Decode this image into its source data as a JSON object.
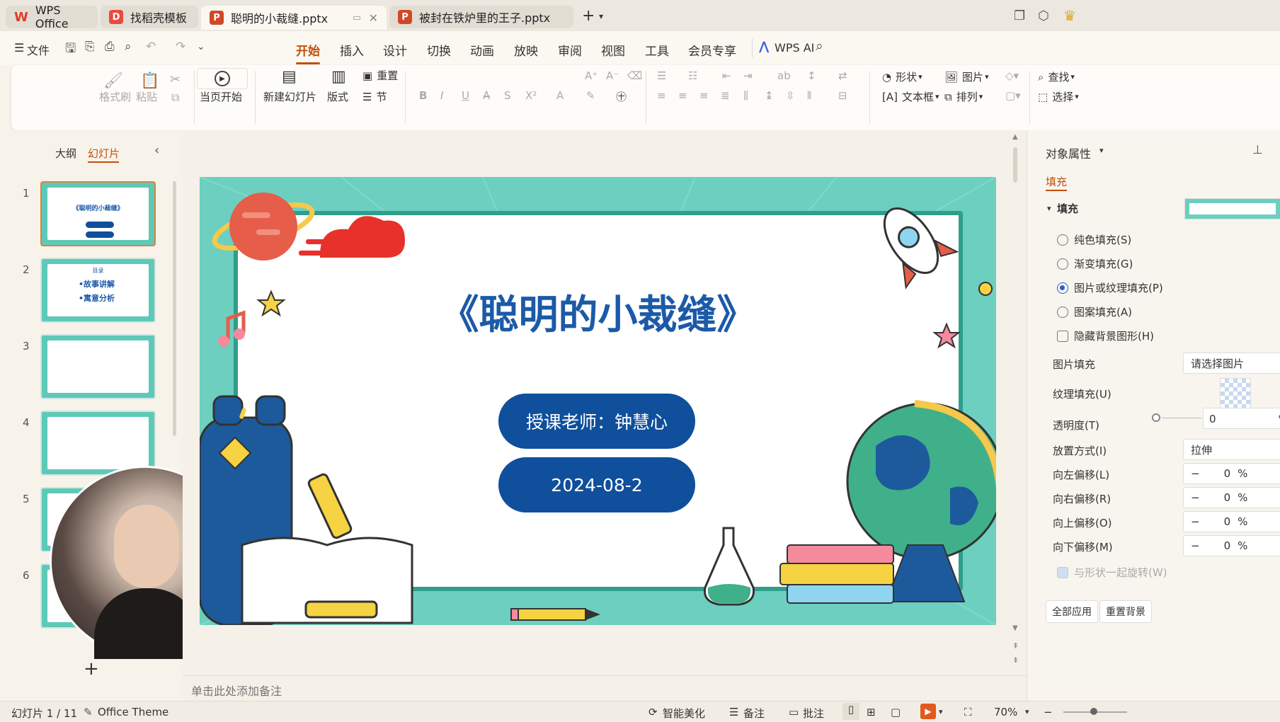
{
  "tabs": [
    {
      "label": "WPS Office",
      "icon": "wps-logo-icon"
    },
    {
      "label": "找稻壳模板",
      "icon": "docer-icon"
    },
    {
      "label": "聪明的小裁缝.pptx",
      "icon": "pptx-icon"
    },
    {
      "label": "被封在铁炉里的王子.pptx",
      "icon": "pptx-icon"
    }
  ],
  "menu": {
    "file": "文件",
    "items": [
      "开始",
      "插入",
      "设计",
      "切换",
      "动画",
      "放映",
      "审阅",
      "视图",
      "工具",
      "会员专享"
    ],
    "ai": "WPS AI"
  },
  "ribbon": {
    "format_painter": "格式刷",
    "paste": "粘贴",
    "start_from_current": "当页开始",
    "new_slide": "新建幻灯片",
    "layout": "版式",
    "reset": "重置",
    "section": "节",
    "shape": "形状",
    "picture": "图片",
    "textbox": "文本框",
    "arrange": "排列",
    "find": "查找",
    "select": "选择"
  },
  "left_panel": {
    "outline_tab": "大纲",
    "slides_tab": "幻灯片",
    "slide_numbers": [
      "1",
      "2",
      "3",
      "4",
      "5",
      "6"
    ],
    "thumb1_title": "《聪明的小裁缝》",
    "thumb2_title": "目录",
    "thumb2_items": [
      "•故事讲解",
      "•寓意分析"
    ]
  },
  "slide": {
    "title": "《聪明的小裁缝》",
    "teacher": "授课老师：钟慧心",
    "date": "2024-08-2"
  },
  "notes_placeholder": "单击此处添加备注",
  "right_panel": {
    "title": "对象属性",
    "fill_tab": "填充",
    "fill_section": "填充",
    "fill_options": [
      {
        "label": "纯色填充(S)",
        "selected": false
      },
      {
        "label": "渐变填充(G)",
        "selected": false
      },
      {
        "label": "图片或纹理填充(P)",
        "selected": true
      },
      {
        "label": "图案填充(A)",
        "selected": false
      }
    ],
    "hide_bg": "隐藏背景图形(H)",
    "picture_fill_label": "图片填充",
    "picture_fill_value": "请选择图片",
    "texture_fill_label": "纹理填充(U)",
    "transparency_label": "透明度(T)",
    "transparency_value": "0",
    "percent": "%",
    "placement_label": "放置方式(I)",
    "placement_value": "拉伸",
    "offsets": [
      {
        "label": "向左偏移(L)",
        "value": "0"
      },
      {
        "label": "向右偏移(R)",
        "value": "0"
      },
      {
        "label": "向上偏移(O)",
        "value": "0"
      },
      {
        "label": "向下偏移(M)",
        "value": "0"
      }
    ],
    "rotate_with_shape": "与形状一起旋转(W)",
    "apply_all": "全部应用",
    "reset_bg": "重置背景"
  },
  "status": {
    "slide_counter": "幻灯片 1 / 11",
    "theme": "Office Theme",
    "smart_beautify": "智能美化",
    "notes": "备注",
    "comments": "批注",
    "zoom": "70%"
  },
  "colors": {
    "accent": "#c14f0d",
    "slide_teal": "#6dcfbf",
    "pill_blue": "#0f4f9c",
    "title_blue": "#1c5aa8"
  }
}
